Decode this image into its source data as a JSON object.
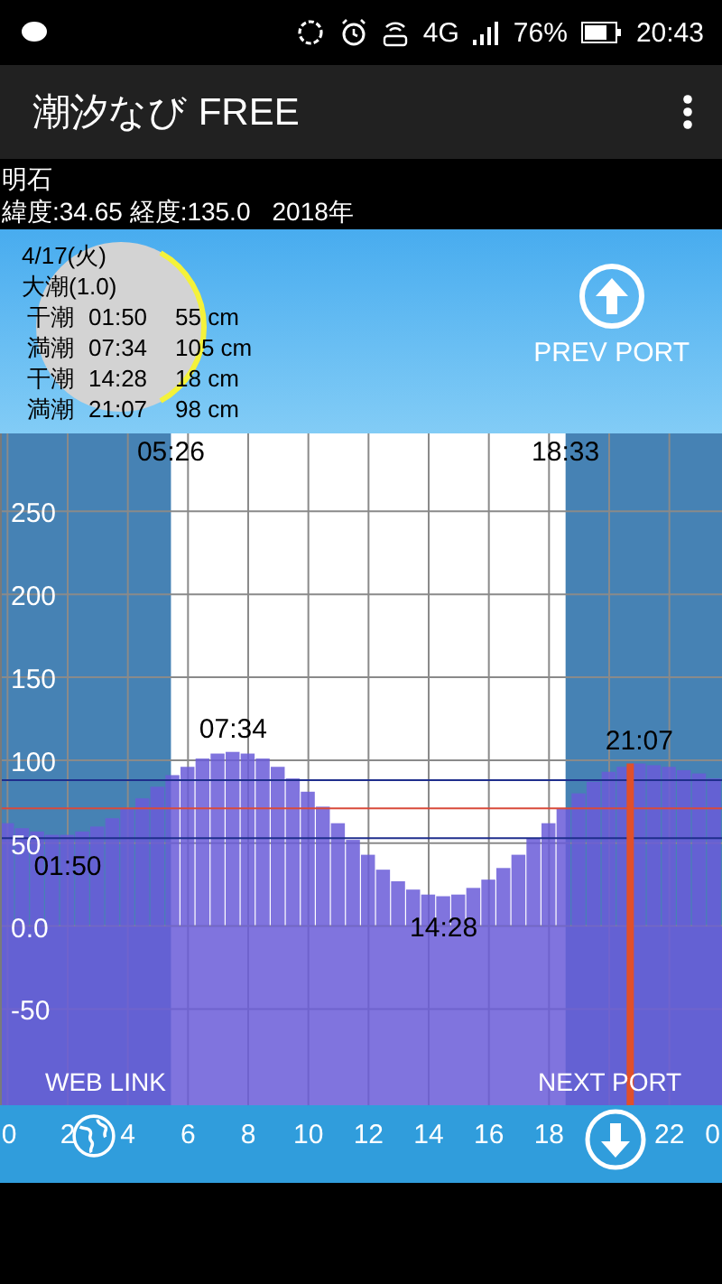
{
  "status_bar": {
    "network": "4G",
    "battery": "76%",
    "time": "20:43"
  },
  "app_bar": {
    "title": "潮汐なび FREE"
  },
  "location": {
    "name": "明石",
    "coords": "緯度:34.65 経度:135.0",
    "year": "2018年"
  },
  "day_panel": {
    "date": "4/17(火)",
    "tide_type": "大潮(1.0)",
    "tides": [
      {
        "label": "干潮",
        "time": "01:50",
        "height": "55 cm"
      },
      {
        "label": "満潮",
        "time": "07:34",
        "height": "105 cm"
      },
      {
        "label": "干潮",
        "time": "14:28",
        "height": "18 cm"
      },
      {
        "label": "満潮",
        "time": "21:07",
        "height": "98 cm"
      }
    ],
    "prev_button": "PREV PORT"
  },
  "chart": {
    "web_link": "WEB LINK",
    "next_button": "NEXT PORT",
    "axis_end_label": "0",
    "chart_data": {
      "type": "bar",
      "xlim": [
        -0.25,
        23.75
      ],
      "ylim": [
        -108,
        297
      ],
      "grid": true,
      "x": [
        0,
        0.5,
        1,
        1.5,
        2,
        2.5,
        3,
        3.5,
        4,
        4.5,
        5,
        5.5,
        6,
        6.5,
        7,
        7.5,
        8,
        8.5,
        9,
        9.5,
        10,
        10.5,
        11,
        11.5,
        12,
        12.5,
        13,
        13.5,
        14,
        14.5,
        15,
        15.5,
        16,
        16.5,
        17,
        17.5,
        18,
        18.5,
        19,
        19.5,
        20,
        20.5,
        21,
        21.5,
        22,
        22.5,
        23,
        23.5
      ],
      "values": [
        62,
        59,
        57,
        55,
        55,
        57,
        60,
        65,
        71,
        77,
        84,
        91,
        96,
        101,
        104,
        105,
        104,
        101,
        96,
        89,
        81,
        72,
        62,
        52,
        43,
        34,
        27,
        22,
        19,
        18,
        19,
        23,
        28,
        35,
        43,
        53,
        62,
        71,
        80,
        87,
        93,
        96,
        98,
        97,
        96,
        94,
        92,
        89
      ],
      "xticks": [
        {
          "value": 0,
          "label": "0"
        },
        {
          "value": 2,
          "label": "2"
        },
        {
          "value": 4,
          "label": "4"
        },
        {
          "value": 6,
          "label": "6"
        },
        {
          "value": 8,
          "label": "8"
        },
        {
          "value": 10,
          "label": "10"
        },
        {
          "value": 12,
          "label": "12"
        },
        {
          "value": 14,
          "label": "14"
        },
        {
          "value": 16,
          "label": "16"
        },
        {
          "value": 18,
          "label": "18"
        },
        {
          "value": 22,
          "label": "22"
        }
      ],
      "yticks": [
        {
          "value": -50,
          "label": "-50"
        },
        {
          "value": 0,
          "label": "0.0"
        },
        {
          "value": 50,
          "label": "50"
        },
        {
          "value": 100,
          "label": "100"
        },
        {
          "value": 150,
          "label": "150"
        },
        {
          "value": 200,
          "label": "200"
        },
        {
          "value": 250,
          "label": "250"
        }
      ],
      "bands": [
        {
          "axis": "x",
          "from": 5.433,
          "to": 18.55
        }
      ],
      "ref_lines": [
        {
          "axis": "y",
          "value": 88,
          "color": "#1f2e8c"
        },
        {
          "axis": "y",
          "value": 71,
          "color": "#d94a3a"
        },
        {
          "axis": "y",
          "value": 53,
          "color": "#1f2e8c"
        },
        {
          "axis": "x",
          "value": 20.7,
          "color": "#e0502a"
        }
      ],
      "annotations": [
        "05:26",
        "18:33",
        {
          "text": "01:50",
          "x": 2,
          "y": 55
        },
        {
          "text": "07:34",
          "x": 7.5,
          "y": 105
        },
        {
          "text": "14:28",
          "x": 14.5,
          "y": 18
        },
        {
          "text": "21:07",
          "x": 21,
          "y": 98
        }
      ]
    }
  }
}
